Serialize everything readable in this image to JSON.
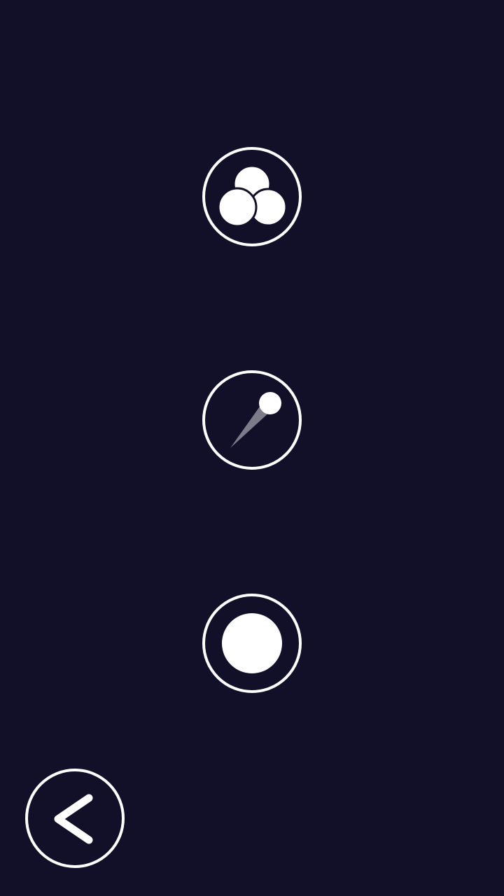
{
  "theme": {
    "background": "#120f28",
    "foreground": "#ffffff"
  },
  "menu": {
    "buttons": [
      {
        "id": "multi-ball",
        "icon": "three-balls-icon"
      },
      {
        "id": "shot",
        "icon": "ball-trail-icon"
      },
      {
        "id": "single-ball",
        "icon": "single-ball-icon"
      }
    ]
  },
  "navigation": {
    "back": {
      "icon": "chevron-left-icon"
    }
  }
}
